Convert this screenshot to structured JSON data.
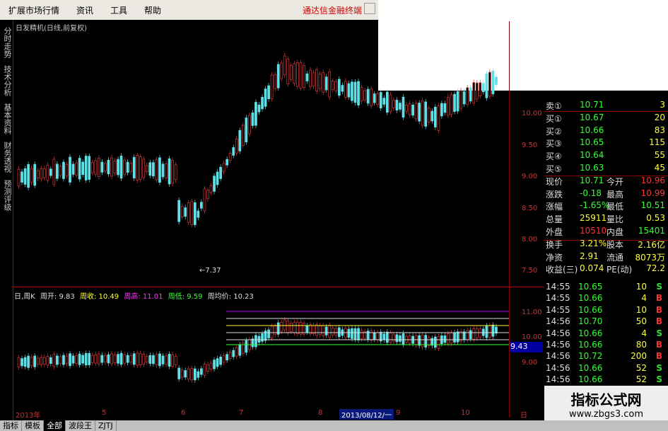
{
  "menubar": {
    "items": [
      "扩展市场行情",
      "资讯",
      "工具",
      "帮助"
    ],
    "brand": "通达信金融终端"
  },
  "left_tabs": [
    "分时走势",
    "技术分析",
    "基本资料",
    "财务透视",
    "预测评级"
  ],
  "chart": {
    "title": "日发精机(日线,前复权)",
    "low_annotation": "←7.37",
    "y_labels": [
      "10.00",
      "9.50",
      "9.00",
      "8.50",
      "8.00",
      "7.50"
    ]
  },
  "week_line": {
    "label": "日,周K",
    "open": "周开: 9.83",
    "close": "周收: 10.49",
    "high": "周高: 11.01",
    "low": "周低: 9.59",
    "avg": "周均价: 10.23"
  },
  "week_y_labels": [
    "11.00",
    "10.00",
    "9.00"
  ],
  "price_box": "9.43",
  "axis_labels": [
    "2013年",
    "5",
    "6",
    "7",
    "8",
    "2013/08/12/一",
    "9",
    "10",
    "日"
  ],
  "quote": {
    "order_book": [
      {
        "label": "卖①",
        "price": "10.71",
        "vol": "3"
      },
      {
        "label": "买①",
        "price": "10.67",
        "vol": "20"
      },
      {
        "label": "买②",
        "price": "10.66",
        "vol": "83"
      },
      {
        "label": "买③",
        "price": "10.65",
        "vol": "115"
      },
      {
        "label": "买④",
        "price": "10.64",
        "vol": "55"
      },
      {
        "label": "买⑤",
        "price": "10.63",
        "vol": "45"
      }
    ],
    "stats": [
      {
        "l1": "现价",
        "v1": "10.71",
        "l2": "今开",
        "v2": "10.96"
      },
      {
        "l1": "涨跌",
        "v1": "-0.18",
        "l2": "最高",
        "v2": "10.99"
      },
      {
        "l1": "涨幅",
        "v1": "-1.65%",
        "l2": "最低",
        "v2": "10.51"
      },
      {
        "l1": "总量",
        "v1": "25911",
        "l2": "量比",
        "v2": "0.53"
      },
      {
        "l1": "外盘",
        "v1": "10510",
        "l2": "内盘",
        "v2": "15401"
      }
    ],
    "fin": [
      {
        "l1": "换手",
        "v1": "3.21%",
        "l2": "股本",
        "v2": "2.16亿"
      },
      {
        "l1": "净资",
        "v1": "2.91",
        "l2": "流通",
        "v2": "8073万"
      },
      {
        "l1": "收益(三)",
        "v1": "0.074",
        "l2": "PE(动)",
        "v2": "72.2"
      }
    ]
  },
  "ticks": [
    {
      "time": "14:55",
      "price": "10.65",
      "vol": "10",
      "side": "S"
    },
    {
      "time": "14:55",
      "price": "10.66",
      "vol": "4",
      "side": "B"
    },
    {
      "time": "14:55",
      "price": "10.66",
      "vol": "10",
      "side": "B"
    },
    {
      "time": "14:56",
      "price": "10.70",
      "vol": "50",
      "side": "B"
    },
    {
      "time": "14:56",
      "price": "10.66",
      "vol": "4",
      "side": "S"
    },
    {
      "time": "14:56",
      "price": "10.66",
      "vol": "80",
      "side": "B"
    },
    {
      "time": "14:56",
      "price": "10.72",
      "vol": "200",
      "side": "B"
    },
    {
      "time": "14:56",
      "price": "10.66",
      "vol": "52",
      "side": "S"
    },
    {
      "time": "14:56",
      "price": "10.66",
      "vol": "52",
      "side": "S"
    }
  ],
  "bottom_tabs": [
    "指标",
    "模板",
    "全部",
    "波段王",
    "ZJTJ"
  ],
  "watermark": {
    "line1": "指标公式网",
    "line2": "www.zbgs3.com"
  },
  "colors": {
    "up": "#d23a3a",
    "down": "#5fe0e6",
    "buy": "#ff3030",
    "sell": "#30e030"
  }
}
